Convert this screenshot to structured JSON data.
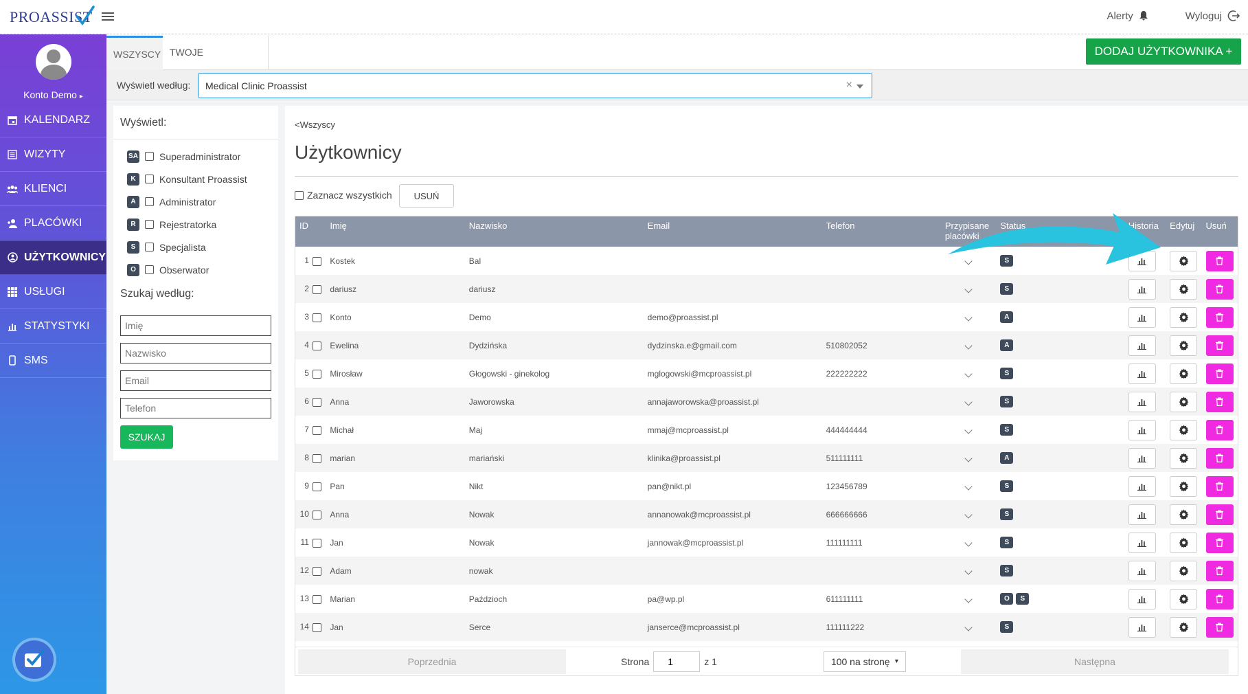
{
  "brand": {
    "logo_text": "PROASSIST"
  },
  "topbar": {
    "alerts_label": "Alerty",
    "logout_label": "Wyloguj"
  },
  "profile": {
    "name": "Konto Demo"
  },
  "sidebar": {
    "items": [
      {
        "label": "KALENDARZ",
        "icon": "calendar-icon"
      },
      {
        "label": "WIZYTY",
        "icon": "list-icon"
      },
      {
        "label": "KLIENCI",
        "icon": "users-icon"
      },
      {
        "label": "PLACÓWKI",
        "icon": "user-plus-icon"
      },
      {
        "label": "UŻYTKOWNICY",
        "icon": "user-circle-icon",
        "active": true
      },
      {
        "label": "USŁUGI",
        "icon": "grid-icon"
      },
      {
        "label": "STATYSTYKI",
        "icon": "bar-chart-icon"
      },
      {
        "label": "SMS",
        "icon": "phone-icon"
      }
    ]
  },
  "tabs": [
    {
      "label": "WSZYSCY",
      "active": true
    },
    {
      "label": "TWOJE USTAWIENIA"
    }
  ],
  "add_user_button": "DODAJ UŻYTKOWNIKA +",
  "filter": {
    "label": "Wyświetl według:",
    "selected_clinic": "Medical Clinic Proassist",
    "clear": "×"
  },
  "left_panel": {
    "title": "Wyświetl:",
    "roles": [
      {
        "badge": "SA",
        "label": "Superadministrator"
      },
      {
        "badge": "K",
        "label": "Konsultant Proassist"
      },
      {
        "badge": "A",
        "label": "Administrator"
      },
      {
        "badge": "R",
        "label": "Rejestratorka"
      },
      {
        "badge": "S",
        "label": "Specjalista"
      },
      {
        "badge": "O",
        "label": "Obserwator"
      }
    ],
    "search_title": "Szukaj według:",
    "placeholders": {
      "first_name": "Imię",
      "last_name": "Nazwisko",
      "email": "Email",
      "phone": "Telefon"
    },
    "search_button": "SZUKAJ"
  },
  "main": {
    "back_link": "<Wszyscy",
    "title": "Użytkownicy",
    "select_all": "Zaznacz wszystkich",
    "delete_button": "USUŃ"
  },
  "table": {
    "headers": {
      "id": "ID",
      "first_name": "Imię",
      "last_name": "Nazwisko",
      "email": "Email",
      "phone": "Telefon",
      "clinics": "Przypisane placówki",
      "status": "Status",
      "history": "Historia",
      "edit": "Edytuj",
      "delete": "Usuń"
    },
    "rows": [
      {
        "id": "1",
        "first": "Kostek",
        "last": "Bal",
        "email": "",
        "phone": "",
        "status": [
          "S"
        ]
      },
      {
        "id": "2",
        "first": "dariusz",
        "last": "dariusz",
        "email": "",
        "phone": "",
        "status": [
          "S"
        ]
      },
      {
        "id": "3",
        "first": "Konto",
        "last": "Demo",
        "email": "demo@proassist.pl",
        "phone": "",
        "status": [
          "A"
        ]
      },
      {
        "id": "4",
        "first": "Ewelina",
        "last": "Dydzińska",
        "email": "dydzinska.e@gmail.com",
        "phone": "510802052",
        "status": [
          "A"
        ]
      },
      {
        "id": "5",
        "first": "Mirosław",
        "last": "Głogowski - ginekolog",
        "email": "mglogowski@mcproassist.pl",
        "phone": "222222222",
        "status": [
          "S"
        ]
      },
      {
        "id": "6",
        "first": "Anna",
        "last": "Jaworowska",
        "email": "annajaworowska@proassist.pl",
        "phone": "",
        "status": [
          "S"
        ]
      },
      {
        "id": "7",
        "first": "Michał",
        "last": "Maj",
        "email": "mmaj@mcproassist.pl",
        "phone": "444444444",
        "status": [
          "S"
        ]
      },
      {
        "id": "8",
        "first": "marian",
        "last": "mariański",
        "email": "klinika@proassist.pl",
        "phone": "511111111",
        "status": [
          "A"
        ]
      },
      {
        "id": "9",
        "first": "Pan",
        "last": "Nikt",
        "email": "pan@nikt.pl",
        "phone": "123456789",
        "status": [
          "S"
        ]
      },
      {
        "id": "10",
        "first": "Anna",
        "last": "Nowak",
        "email": "annanowak@mcproassist.pl",
        "phone": "666666666",
        "status": [
          "S"
        ]
      },
      {
        "id": "11",
        "first": "Jan",
        "last": "Nowak",
        "email": "jannowak@mcproassist.pl",
        "phone": "111111111",
        "status": [
          "S"
        ]
      },
      {
        "id": "12",
        "first": "Adam",
        "last": "nowak",
        "email": "",
        "phone": "",
        "status": [
          "S"
        ]
      },
      {
        "id": "13",
        "first": "Marian",
        "last": "Paździoch",
        "email": "pa@wp.pl",
        "phone": "611111111",
        "status": [
          "O",
          "S"
        ]
      },
      {
        "id": "14",
        "first": "Jan",
        "last": "Serce",
        "email": "janserce@mcproassist.pl",
        "phone": "111111222",
        "status": [
          "S"
        ]
      }
    ]
  },
  "pagination": {
    "prev": "Poprzednia",
    "page_label": "Strona",
    "page": "1",
    "of": "z 1",
    "per_page": "100 na stronę",
    "next": "Następna"
  },
  "colors": {
    "accent": "#2d8fe0",
    "success": "#17a34a",
    "delete": "#f02ae0",
    "header": "#8b96a8",
    "badge": "#3f4a5a",
    "annotation_arrow": "#29c3e0"
  }
}
